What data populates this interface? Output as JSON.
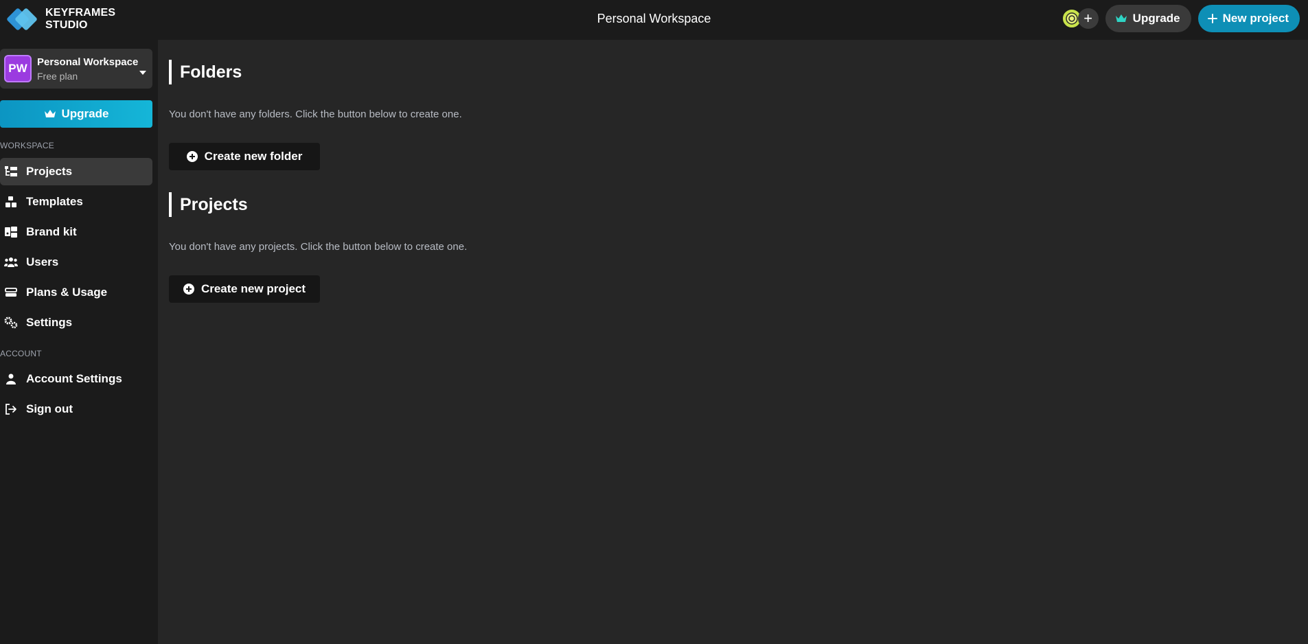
{
  "header": {
    "logo_line1": "KEYFRAMES",
    "logo_line2": "STUDIO",
    "title": "Personal Workspace",
    "add_member_label": "+",
    "upgrade_label": "Upgrade",
    "new_project_label": "New project",
    "avatar_initial": "@"
  },
  "sidebar": {
    "workspace": {
      "initials": "PW",
      "name": "Personal Workspace",
      "plan": "Free plan"
    },
    "upgrade_label": "Upgrade",
    "workspace_section": "WORKSPACE",
    "workspace_items": [
      {
        "label": "Projects",
        "icon": "folder-tree-icon",
        "active": true
      },
      {
        "label": "Templates",
        "icon": "templates-icon",
        "active": false
      },
      {
        "label": "Brand kit",
        "icon": "brand-kit-icon",
        "active": false
      },
      {
        "label": "Users",
        "icon": "users-icon",
        "active": false
      },
      {
        "label": "Plans & Usage",
        "icon": "plans-icon",
        "active": false
      },
      {
        "label": "Settings",
        "icon": "gears-icon",
        "active": false
      }
    ],
    "account_section": "ACCOUNT",
    "account_items": [
      {
        "label": "Account Settings",
        "icon": "user-icon"
      },
      {
        "label": "Sign out",
        "icon": "sign-out-icon"
      }
    ]
  },
  "main": {
    "folders": {
      "heading": "Folders",
      "empty_message": "You don't have any folders. Click the button below to create one.",
      "create_label": "Create new folder"
    },
    "projects": {
      "heading": "Projects",
      "empty_message": "You don't have any projects. Click the button below to create one.",
      "create_label": "Create new project"
    }
  },
  "colors": {
    "accent": "#0e8fb6",
    "workspace_badge": "#9b3be0",
    "crown_teal": "#2fd4c4"
  }
}
